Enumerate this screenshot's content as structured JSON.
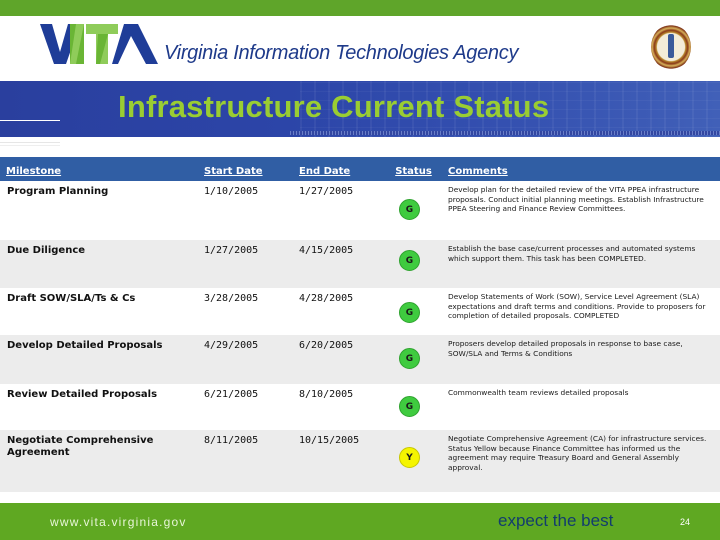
{
  "header": {
    "logo_text": "VITA",
    "agency_name": "Virginia Information Technologies Agency",
    "seal_alt": "Commonwealth of Virginia seal",
    "title": "Infrastructure Current Status"
  },
  "colors": {
    "brand_green": "#5fa52a",
    "brand_blue": "#2a3f9e",
    "title_green": "#9acd32",
    "table_header_blue": "#305ea4",
    "status_green": "#3fcb3f",
    "status_yellow": "#f5f500"
  },
  "table": {
    "columns": [
      "Milestone",
      "Start Date",
      "End Date",
      "Status",
      "Comments"
    ],
    "rows": [
      {
        "milestone": "Program Planning",
        "start": "1/10/2005",
        "end": "1/27/2005",
        "status": "G",
        "comment": "Develop plan for the detailed review of the VITA PPEA infrastructure proposals. Conduct initial planning meetings. Establish Infrastructure PPEA Steering and Finance Review Committees."
      },
      {
        "milestone": "Due Diligence",
        "start": "1/27/2005",
        "end": "4/15/2005",
        "status": "G",
        "comment": "Establish the base case/current processes and automated systems which support them. This task has been COMPLETED."
      },
      {
        "milestone": "Draft SOW/SLA/Ts & Cs",
        "start": "3/28/2005",
        "end": "4/28/2005",
        "status": "G",
        "comment": "Develop Statements of Work (SOW), Service Level Agreement (SLA) expectations and draft terms and conditions. Provide to proposers for completion of detailed proposals. COMPLETED"
      },
      {
        "milestone": "Develop Detailed Proposals",
        "start": "4/29/2005",
        "end": "6/20/2005",
        "status": "G",
        "comment": "Proposers develop detailed proposals in response to base case, SOW/SLA and Terms & Conditions"
      },
      {
        "milestone": "Review Detailed Proposals",
        "start": "6/21/2005",
        "end": "8/10/2005",
        "status": "G",
        "comment": "Commonwealth team reviews detailed proposals"
      },
      {
        "milestone": "Negotiate Comprehensive Agreement",
        "start": "8/11/2005",
        "end": "10/15/2005",
        "status": "Y",
        "comment": "Negotiate Comprehensive Agreement (CA) for infrastructure services. Status Yellow because Finance Committee has informed us the agreement may require Treasury Board and General Assembly approval."
      }
    ]
  },
  "footer": {
    "url": "www.vita.virginia.gov",
    "tagline": "expect the best",
    "page_number": "24"
  }
}
